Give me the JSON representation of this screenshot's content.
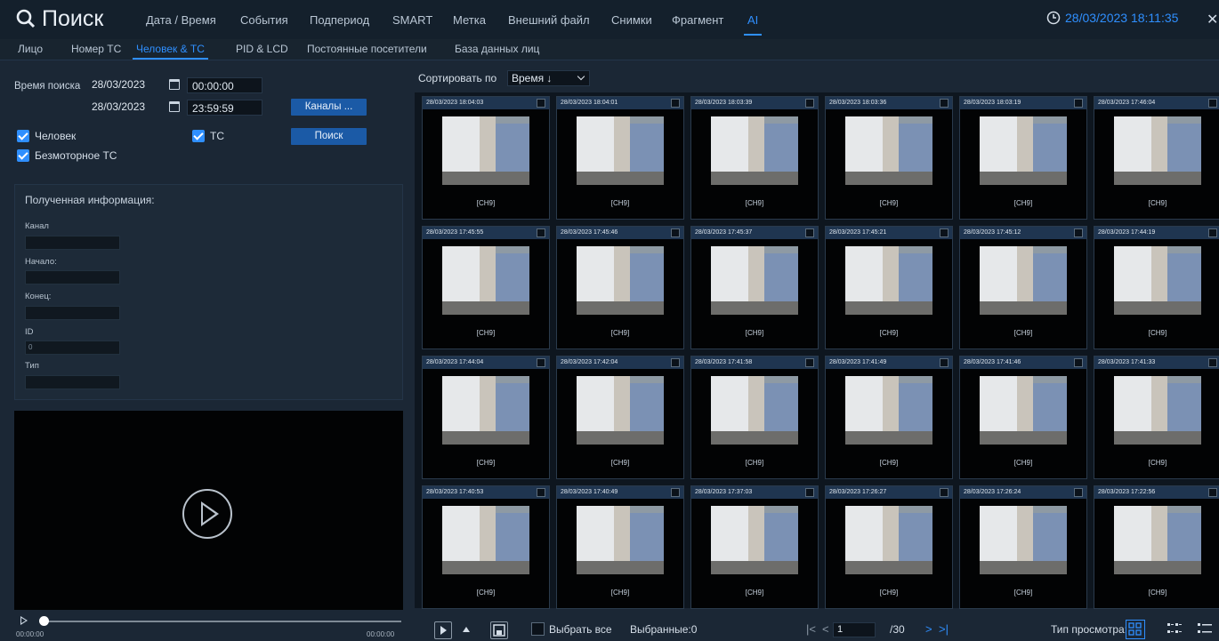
{
  "header": {
    "title": "Поиск",
    "menu": [
      "Дата / Время",
      "События",
      "Подпериод",
      "SMART",
      "Метка",
      "Внешний файл",
      "Снимки",
      "Фрагмент",
      "AI"
    ],
    "active_menu": "AI",
    "datetime": "28/03/2023 18:11:35"
  },
  "subtabs": [
    "Лицо",
    "Номер ТС",
    "Человек & ТС",
    "PID & LCD",
    "Постоянные посетители",
    "База данных лиц"
  ],
  "active_subtab": "Человек & ТС",
  "search": {
    "time_label": "Время поиска",
    "start_date": "28/03/2023",
    "start_time": "00:00:00",
    "end_date": "28/03/2023",
    "end_time": "23:59:59",
    "channels_button": "Каналы ...",
    "search_button": "Поиск",
    "checkboxes": {
      "human": "Человек",
      "vehicle": "ТС",
      "nonmotor": "Безмоторное ТС"
    }
  },
  "info": {
    "title": "Полученная информация:",
    "channel_label": "Канал",
    "start_label": "Начало:",
    "end_label": "Конец:",
    "id_label": "ID",
    "id_value": "0",
    "type_label": "Тип"
  },
  "player": {
    "start_time": "00:00:00",
    "end_time": "00:00:00"
  },
  "sort": {
    "label": "Сортировать по",
    "value": "Время ↓"
  },
  "results": {
    "channel_tag": "[CH9]",
    "timestamps": [
      "28/03/2023 18:04:03",
      "28/03/2023 18:04:01",
      "28/03/2023 18:03:39",
      "28/03/2023 18:03:36",
      "28/03/2023 18:03:19",
      "28/03/2023 17:46:04",
      "28/03/2023 17:45:55",
      "28/03/2023 17:45:46",
      "28/03/2023 17:45:37",
      "28/03/2023 17:45:21",
      "28/03/2023 17:45:12",
      "28/03/2023 17:44:19",
      "28/03/2023 17:44:04",
      "28/03/2023 17:42:04",
      "28/03/2023 17:41:58",
      "28/03/2023 17:41:49",
      "28/03/2023 17:41:46",
      "28/03/2023 17:41:33",
      "28/03/2023 17:40:53",
      "28/03/2023 17:40:49",
      "28/03/2023 17:37:03",
      "28/03/2023 17:26:27",
      "28/03/2023 17:26:24",
      "28/03/2023 17:22:56"
    ]
  },
  "footer": {
    "select_all": "Выбрать все",
    "selected": "Выбранные:0",
    "page": "1",
    "total_pages": "/30",
    "view_type": "Тип просмотра:"
  },
  "colors": {
    "accent": "#2f8fff",
    "background": "#1b2735",
    "header": "#14202c",
    "button": "#1b5aa6"
  }
}
